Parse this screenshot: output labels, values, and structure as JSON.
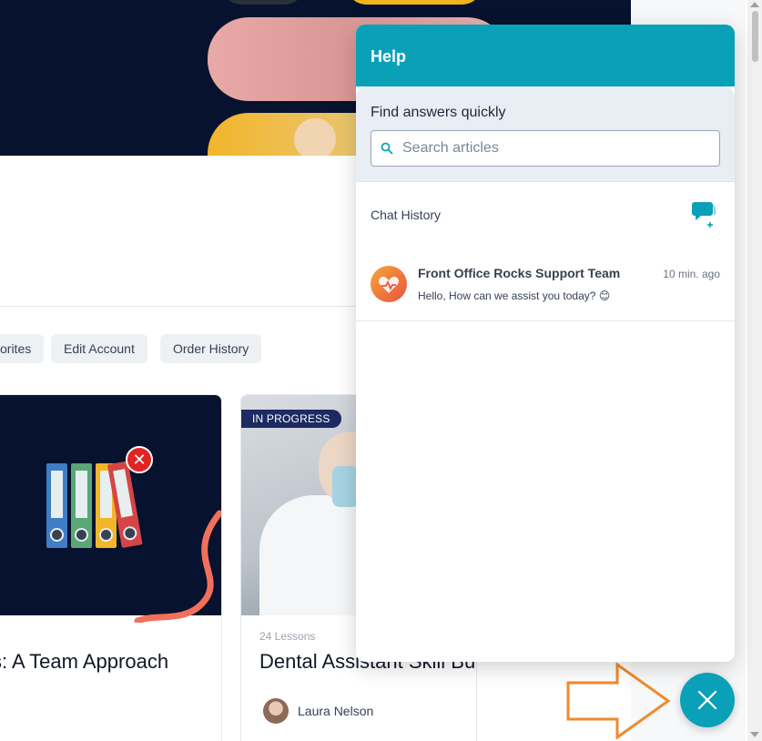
{
  "page": {
    "chips": [
      "orites",
      "Edit Account",
      "Order History"
    ],
    "cards": [
      {
        "title": "s: A Team Approach"
      },
      {
        "badge": "IN PROGRESS",
        "lessons": "24 Lessons",
        "title": "Dental Assistant Skill Building",
        "author": "Laura Nelson"
      }
    ]
  },
  "help": {
    "title": "Help",
    "search_label": "Find answers quickly",
    "search_placeholder": "Search articles",
    "chat_history_label": "Chat History",
    "conversations": [
      {
        "name": "Front Office Rocks Support Team",
        "time": "10 min. ago",
        "message": "Hello, How can we assist you today? 😊"
      }
    ]
  },
  "colors": {
    "accent": "#0aa1b8",
    "hero": "#07122e",
    "arrow": "#f08a2c"
  },
  "icons": {
    "search": "search-icon",
    "new_chat": "new-chat-icon",
    "close": "close-icon"
  }
}
